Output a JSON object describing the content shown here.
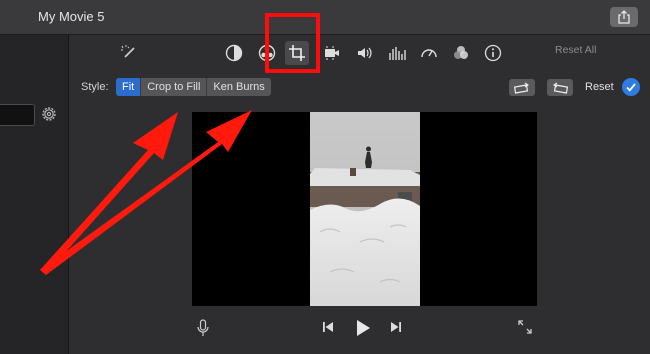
{
  "window": {
    "title": "My Movie 5"
  },
  "toolbar": {
    "tools": [
      "magic-wand",
      "color-balance",
      "color-correction",
      "crop",
      "stabilization",
      "volume",
      "noise-reduction-equalizer",
      "speed",
      "clip-filter",
      "info"
    ],
    "reset_all": "Reset All"
  },
  "crop": {
    "style_label": "Style:",
    "options": {
      "fit": "Fit",
      "crop_to_fill": "Crop to Fill",
      "ken_burns": "Ken Burns"
    },
    "selected": "Fit",
    "reset": "Reset"
  },
  "colors": {
    "accent": "#2d6ccf",
    "highlight": "#ff0d0d"
  }
}
